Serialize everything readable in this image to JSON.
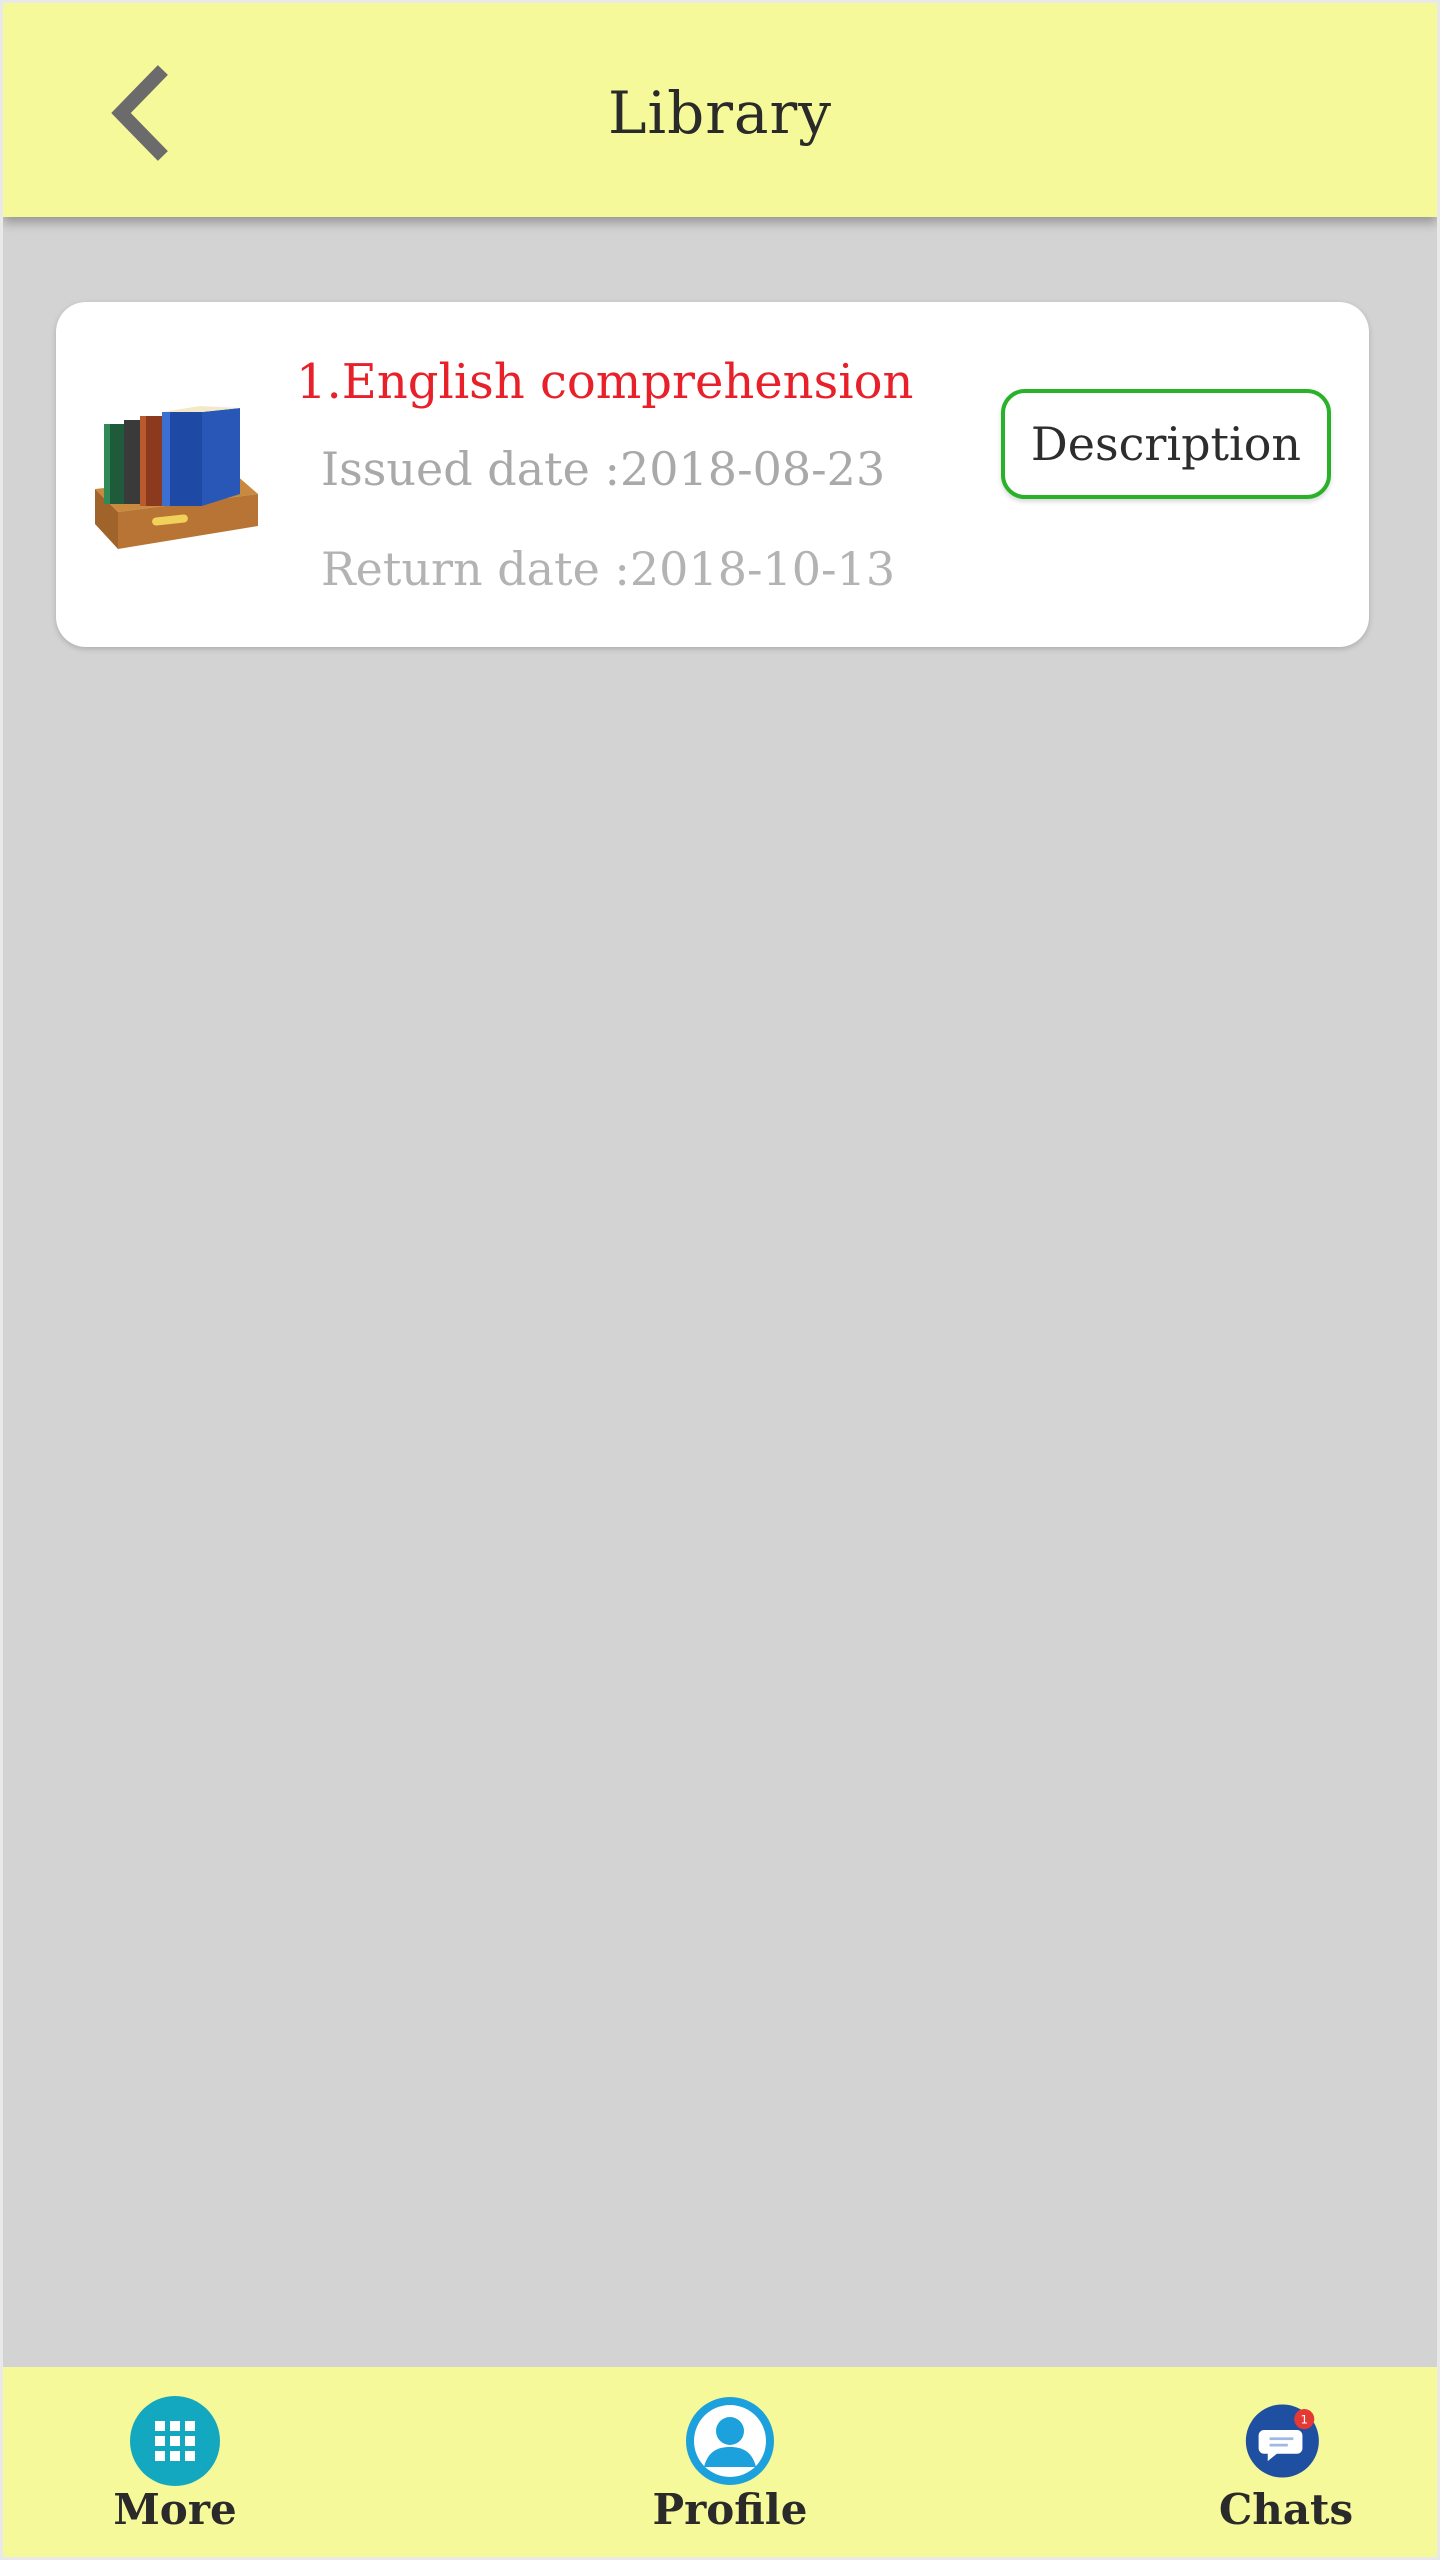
{
  "header": {
    "title": "Library",
    "back_icon": "chevron-left-icon"
  },
  "books": [
    {
      "title": "1.English comprehension",
      "issued": "Issued date :2018-08-23",
      "returned": "Return date :2018-10-13",
      "button_label": "Description",
      "icon": "bookshelf-icon"
    }
  ],
  "bottom_nav": {
    "more": {
      "label": "More",
      "icon": "grid-icon"
    },
    "profile": {
      "label": "Profile",
      "icon": "user-icon"
    },
    "chats": {
      "label": "Chats",
      "icon": "chat-bubble-icon",
      "badge": "1"
    }
  },
  "colors": {
    "header_bg": "#f6f99a",
    "page_bg": "#d3d3d3",
    "title_red": "#e8202a",
    "button_border": "#29b12a",
    "more_icon": "#13a8bf",
    "profile_icon": "#1da1dd",
    "chats_icon": "#1f4fa0",
    "badge_red": "#e53935"
  }
}
